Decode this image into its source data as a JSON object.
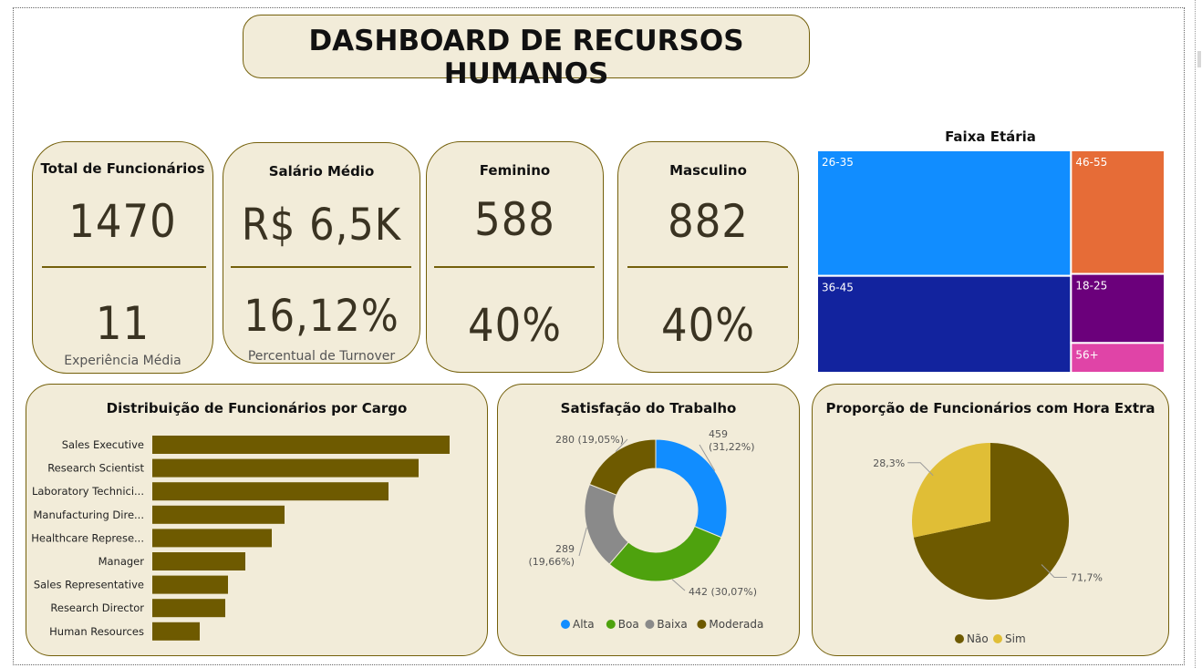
{
  "header": {
    "title": "DASHBOARD DE RECURSOS HUMANOS"
  },
  "kpis": [
    {
      "label": "Total de Funcionários",
      "value": "1470",
      "secondary": "11",
      "caption": "Experiência Média"
    },
    {
      "label": "Salário Médio",
      "value": "R$ 6,5K",
      "secondary": "16,12%",
      "caption": "Percentual de Turnover"
    },
    {
      "label": "Feminino",
      "value": "588",
      "secondary": "40%",
      "caption": ""
    },
    {
      "label": "Masculino",
      "value": "882",
      "secondary": "40%",
      "caption": ""
    }
  ],
  "colors": {
    "card_bg": "#f2ecd9",
    "card_border": "#74600b",
    "bar": "#6e5a00",
    "alta": "#118dff",
    "boa": "#4ea20e",
    "baixa": "#8a8a8a",
    "moderada": "#6e5a00",
    "nao": "#6e5a00",
    "sim": "#e0be36",
    "age_26_35": "#118dff",
    "age_36_45": "#12239e",
    "age_46_55": "#e66c37",
    "age_18_25": "#6b007b",
    "age_56": "#e044a7"
  },
  "chart_data": [
    {
      "type": "treemap",
      "title": "Faixa Etária",
      "categories": [
        "26-35",
        "36-45",
        "46-55",
        "18-25",
        "56+"
      ],
      "values": [
        606,
        468,
        220,
        123,
        53
      ]
    },
    {
      "type": "bar",
      "orientation": "horizontal",
      "title": "Distribuição de Funcionários por Cargo",
      "categories": [
        "Sales Executive",
        "Research Scientist",
        "Laboratory Technici...",
        "Manufacturing Dire...",
        "Healthcare Represe...",
        "Manager",
        "Sales Representative",
        "Research Director",
        "Human Resources"
      ],
      "values": [
        326,
        292,
        259,
        145,
        131,
        102,
        83,
        80,
        52
      ],
      "xlim": [
        0,
        340
      ],
      "grid": false
    },
    {
      "type": "donut",
      "title": "Satisfação do Trabalho",
      "categories": [
        "Alta",
        "Boa",
        "Baixa",
        "Moderada"
      ],
      "values": [
        459,
        442,
        289,
        280
      ],
      "labels": [
        "459 (31,22%)",
        "442 (30,07%)",
        "289 (19,66%)",
        "280 (19,05%)"
      ],
      "legend": "bottom"
    },
    {
      "type": "pie",
      "title": "Proporção de Funcionários com Hora Extra",
      "categories": [
        "Não",
        "Sim"
      ],
      "values": [
        71.7,
        28.3
      ],
      "labels": [
        "71,7%",
        "28,3%"
      ],
      "legend": "bottom"
    }
  ]
}
